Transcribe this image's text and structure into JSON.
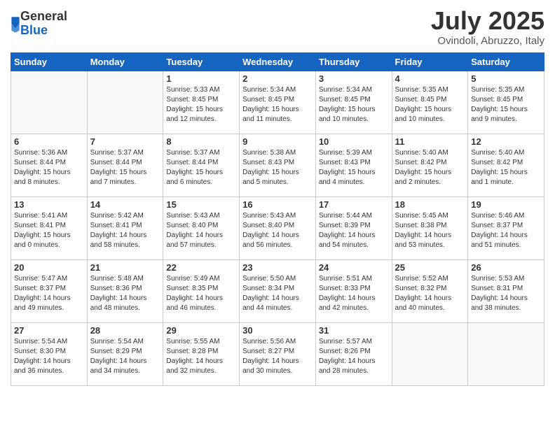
{
  "logo": {
    "general": "General",
    "blue": "Blue"
  },
  "title": "July 2025",
  "location": "Ovindoli, Abruzzo, Italy",
  "days_of_week": [
    "Sunday",
    "Monday",
    "Tuesday",
    "Wednesday",
    "Thursday",
    "Friday",
    "Saturday"
  ],
  "weeks": [
    [
      {
        "day": "",
        "detail": ""
      },
      {
        "day": "",
        "detail": ""
      },
      {
        "day": "1",
        "detail": "Sunrise: 5:33 AM\nSunset: 8:45 PM\nDaylight: 15 hours and 12 minutes."
      },
      {
        "day": "2",
        "detail": "Sunrise: 5:34 AM\nSunset: 8:45 PM\nDaylight: 15 hours and 11 minutes."
      },
      {
        "day": "3",
        "detail": "Sunrise: 5:34 AM\nSunset: 8:45 PM\nDaylight: 15 hours and 10 minutes."
      },
      {
        "day": "4",
        "detail": "Sunrise: 5:35 AM\nSunset: 8:45 PM\nDaylight: 15 hours and 10 minutes."
      },
      {
        "day": "5",
        "detail": "Sunrise: 5:35 AM\nSunset: 8:45 PM\nDaylight: 15 hours and 9 minutes."
      }
    ],
    [
      {
        "day": "6",
        "detail": "Sunrise: 5:36 AM\nSunset: 8:44 PM\nDaylight: 15 hours and 8 minutes."
      },
      {
        "day": "7",
        "detail": "Sunrise: 5:37 AM\nSunset: 8:44 PM\nDaylight: 15 hours and 7 minutes."
      },
      {
        "day": "8",
        "detail": "Sunrise: 5:37 AM\nSunset: 8:44 PM\nDaylight: 15 hours and 6 minutes."
      },
      {
        "day": "9",
        "detail": "Sunrise: 5:38 AM\nSunset: 8:43 PM\nDaylight: 15 hours and 5 minutes."
      },
      {
        "day": "10",
        "detail": "Sunrise: 5:39 AM\nSunset: 8:43 PM\nDaylight: 15 hours and 4 minutes."
      },
      {
        "day": "11",
        "detail": "Sunrise: 5:40 AM\nSunset: 8:42 PM\nDaylight: 15 hours and 2 minutes."
      },
      {
        "day": "12",
        "detail": "Sunrise: 5:40 AM\nSunset: 8:42 PM\nDaylight: 15 hours and 1 minute."
      }
    ],
    [
      {
        "day": "13",
        "detail": "Sunrise: 5:41 AM\nSunset: 8:41 PM\nDaylight: 15 hours and 0 minutes."
      },
      {
        "day": "14",
        "detail": "Sunrise: 5:42 AM\nSunset: 8:41 PM\nDaylight: 14 hours and 58 minutes."
      },
      {
        "day": "15",
        "detail": "Sunrise: 5:43 AM\nSunset: 8:40 PM\nDaylight: 14 hours and 57 minutes."
      },
      {
        "day": "16",
        "detail": "Sunrise: 5:43 AM\nSunset: 8:40 PM\nDaylight: 14 hours and 56 minutes."
      },
      {
        "day": "17",
        "detail": "Sunrise: 5:44 AM\nSunset: 8:39 PM\nDaylight: 14 hours and 54 minutes."
      },
      {
        "day": "18",
        "detail": "Sunrise: 5:45 AM\nSunset: 8:38 PM\nDaylight: 14 hours and 53 minutes."
      },
      {
        "day": "19",
        "detail": "Sunrise: 5:46 AM\nSunset: 8:37 PM\nDaylight: 14 hours and 51 minutes."
      }
    ],
    [
      {
        "day": "20",
        "detail": "Sunrise: 5:47 AM\nSunset: 8:37 PM\nDaylight: 14 hours and 49 minutes."
      },
      {
        "day": "21",
        "detail": "Sunrise: 5:48 AM\nSunset: 8:36 PM\nDaylight: 14 hours and 48 minutes."
      },
      {
        "day": "22",
        "detail": "Sunrise: 5:49 AM\nSunset: 8:35 PM\nDaylight: 14 hours and 46 minutes."
      },
      {
        "day": "23",
        "detail": "Sunrise: 5:50 AM\nSunset: 8:34 PM\nDaylight: 14 hours and 44 minutes."
      },
      {
        "day": "24",
        "detail": "Sunrise: 5:51 AM\nSunset: 8:33 PM\nDaylight: 14 hours and 42 minutes."
      },
      {
        "day": "25",
        "detail": "Sunrise: 5:52 AM\nSunset: 8:32 PM\nDaylight: 14 hours and 40 minutes."
      },
      {
        "day": "26",
        "detail": "Sunrise: 5:53 AM\nSunset: 8:31 PM\nDaylight: 14 hours and 38 minutes."
      }
    ],
    [
      {
        "day": "27",
        "detail": "Sunrise: 5:54 AM\nSunset: 8:30 PM\nDaylight: 14 hours and 36 minutes."
      },
      {
        "day": "28",
        "detail": "Sunrise: 5:54 AM\nSunset: 8:29 PM\nDaylight: 14 hours and 34 minutes."
      },
      {
        "day": "29",
        "detail": "Sunrise: 5:55 AM\nSunset: 8:28 PM\nDaylight: 14 hours and 32 minutes."
      },
      {
        "day": "30",
        "detail": "Sunrise: 5:56 AM\nSunset: 8:27 PM\nDaylight: 14 hours and 30 minutes."
      },
      {
        "day": "31",
        "detail": "Sunrise: 5:57 AM\nSunset: 8:26 PM\nDaylight: 14 hours and 28 minutes."
      },
      {
        "day": "",
        "detail": ""
      },
      {
        "day": "",
        "detail": ""
      }
    ]
  ]
}
